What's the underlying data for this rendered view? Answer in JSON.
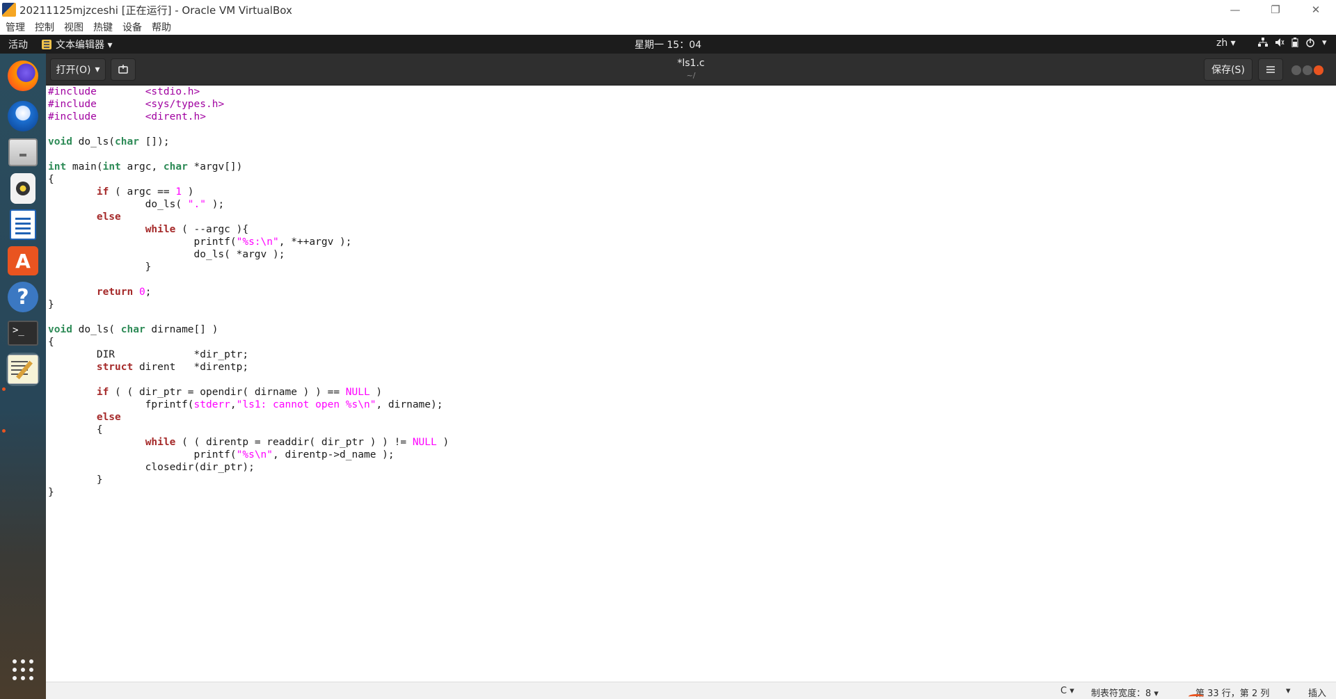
{
  "vbox": {
    "title": "20211125mjzceshi [正在运行] - Oracle VM VirtualBox",
    "menu": [
      "管理",
      "控制",
      "视图",
      "热键",
      "设备",
      "帮助"
    ],
    "win_min": "—",
    "win_restore": "❐",
    "win_close": "✕"
  },
  "topbar": {
    "activities": "活动",
    "app_menu": "文本编辑器 ▾",
    "clock": "星期一 15：04",
    "lang": "zh ▾"
  },
  "dock": {
    "items": [
      {
        "name": "firefox",
        "icon": "firefox-icon"
      },
      {
        "name": "thunderbird",
        "icon": "mail-icon"
      },
      {
        "name": "files",
        "icon": "files-icon"
      },
      {
        "name": "rhythmbox",
        "icon": "music-icon"
      },
      {
        "name": "libreoffice-writer",
        "icon": "document-icon"
      },
      {
        "name": "ubuntu-software",
        "icon": "store-icon"
      },
      {
        "name": "help",
        "icon": "help-icon"
      },
      {
        "name": "terminal",
        "icon": "terminal-icon"
      },
      {
        "name": "text-editor",
        "icon": "text-editor-icon"
      }
    ],
    "show_apps": "apps-grid-icon"
  },
  "editor_header": {
    "open_label": "打开(O)",
    "title": "*ls1.c",
    "path": "~/",
    "save_label": "保存(S)"
  },
  "code_lines": [
    "#include\t<stdio.h>",
    "#include\t<sys/types.h>",
    "#include\t<dirent.h>",
    "",
    "void do_ls(char []);",
    "",
    "int main(int argc, char *argv[])",
    "{",
    "\tif ( argc == 1 )",
    "\t\tdo_ls( \".\" );",
    "\telse",
    "\t\twhile ( --argc ){",
    "\t\t\tprintf(\"%s:\\n\", *++argv );",
    "\t\t\tdo_ls( *argv );",
    "\t\t}",
    "",
    "\treturn 0;",
    "}",
    "",
    "void do_ls( char dirname[] )",
    "{",
    "\tDIR\t\t*dir_ptr;",
    "\tstruct dirent\t*direntp;",
    "",
    "\tif ( ( dir_ptr = opendir( dirname ) ) == NULL )",
    "\t\tfprintf(stderr,\"ls1: cannot open %s\\n\", dirname);",
    "\telse",
    "\t{",
    "\t\twhile ( ( direntp = readdir( dir_ptr ) ) != NULL )",
    "\t\t\tprintf(\"%s\\n\", direntp->d_name );",
    "\t\tclosedir(dir_ptr);",
    "\t}",
    "}"
  ],
  "statusbar": {
    "language": "C ▾",
    "tab_width": "制表符宽度：8 ▾",
    "position": "第 33 行，第 2 列",
    "position_arrow": "▾",
    "insert_mode": "插入"
  },
  "colors": {
    "preprocessor": "#a000a0",
    "keyword": "#a52a2a",
    "type": "#2e8b57",
    "string": "#ff00ff",
    "accent": "#e95420"
  }
}
